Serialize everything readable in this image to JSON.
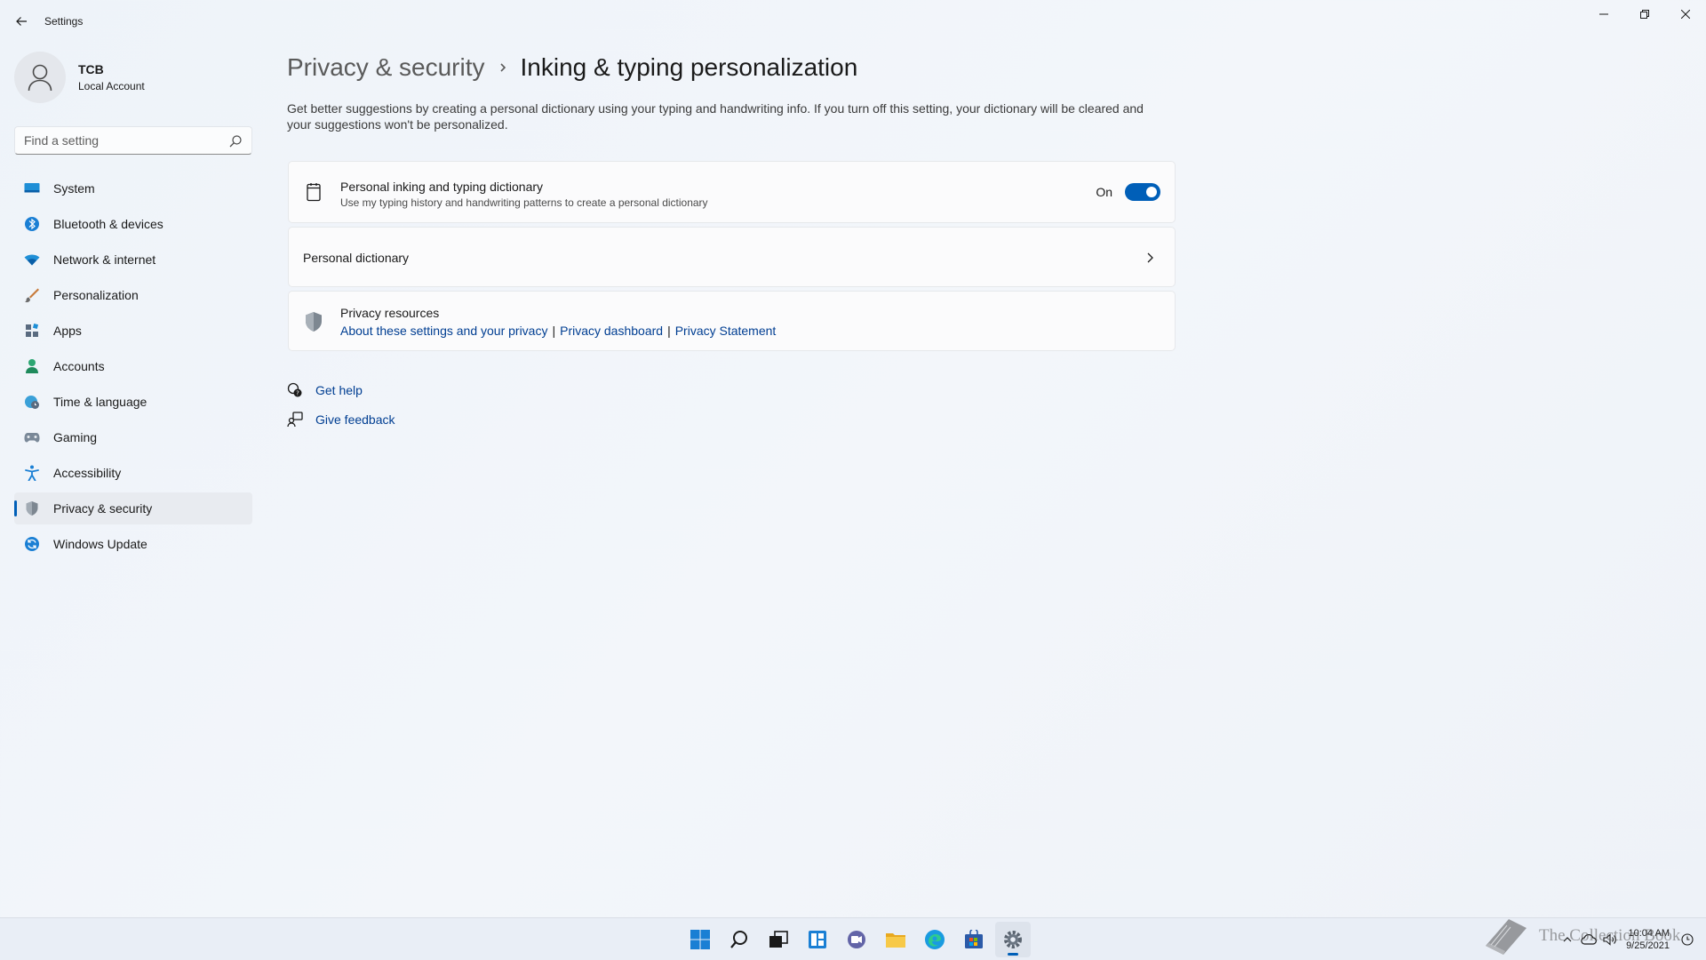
{
  "window": {
    "title": "Settings"
  },
  "profile": {
    "name": "TCB",
    "account_type": "Local Account"
  },
  "search": {
    "placeholder": "Find a setting"
  },
  "sidebar": {
    "items": [
      {
        "label": "System",
        "icon": "system-icon",
        "active": false
      },
      {
        "label": "Bluetooth & devices",
        "icon": "bluetooth-icon",
        "active": false
      },
      {
        "label": "Network & internet",
        "icon": "wifi-icon",
        "active": false
      },
      {
        "label": "Personalization",
        "icon": "brush-icon",
        "active": false
      },
      {
        "label": "Apps",
        "icon": "apps-icon",
        "active": false
      },
      {
        "label": "Accounts",
        "icon": "person-icon",
        "active": false
      },
      {
        "label": "Time & language",
        "icon": "globe-clock-icon",
        "active": false
      },
      {
        "label": "Gaming",
        "icon": "gamepad-icon",
        "active": false
      },
      {
        "label": "Accessibility",
        "icon": "accessibility-icon",
        "active": false
      },
      {
        "label": "Privacy & security",
        "icon": "shield-icon",
        "active": true
      },
      {
        "label": "Windows Update",
        "icon": "update-icon",
        "active": false
      }
    ]
  },
  "breadcrumb": {
    "parent": "Privacy & security",
    "current": "Inking & typing personalization"
  },
  "main": {
    "description_line1": "Get better suggestions by creating a personal dictionary using your typing and handwriting info. If you turn off this setting, your dictionary will be cleared and",
    "description_line2": "your suggestions won't be personalized.",
    "dictionary_setting": {
      "title": "Personal inking and typing dictionary",
      "subtitle": "Use my typing history and handwriting patterns to create a personal dictionary",
      "toggle_label": "On",
      "toggle_on": true
    },
    "personal_dictionary": {
      "title": "Personal dictionary"
    },
    "privacy_resources": {
      "title": "Privacy resources",
      "links": [
        "About these settings and your privacy",
        "Privacy dashboard",
        "Privacy Statement"
      ],
      "separator": "|"
    },
    "help": {
      "get_help": "Get help",
      "give_feedback": "Give feedback"
    }
  },
  "taskbar": {
    "icons": [
      "windows-start-icon",
      "search-icon",
      "task-view-icon",
      "widgets-icon",
      "chat-icon",
      "file-explorer-icon",
      "edge-icon",
      "store-icon",
      "settings-icon"
    ],
    "active": "settings-icon",
    "time": "10:04 AM",
    "date": "9/25/2021"
  },
  "watermark": {
    "text": "The Collection Book"
  },
  "colors": {
    "accent": "#005fb8",
    "link": "#003e92"
  }
}
